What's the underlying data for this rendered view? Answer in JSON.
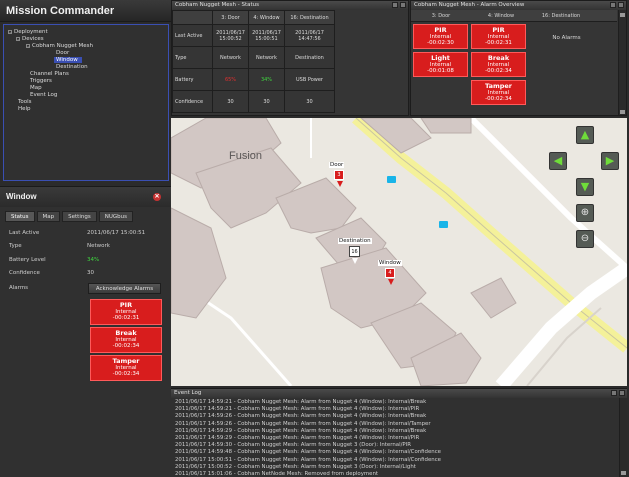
{
  "app": {
    "title": "Mission Commander"
  },
  "tree": {
    "items": [
      {
        "label": "Deployment",
        "toggle": "−"
      },
      {
        "label": "Devices",
        "toggle": "−"
      },
      {
        "label": "Cobham Nugget Mesh",
        "toggle": "−"
      },
      {
        "label": "Door"
      },
      {
        "label": "Window"
      },
      {
        "label": "Destination"
      },
      {
        "label": "Channel Plans"
      },
      {
        "label": "Triggers"
      },
      {
        "label": "Map"
      },
      {
        "label": "Event Log"
      },
      {
        "label": "Tools"
      },
      {
        "label": "Help"
      }
    ]
  },
  "window_panel": {
    "title": "Window",
    "close_icon": "✕",
    "tabs": [
      "Status",
      "Map",
      "Settings",
      "NUGbus"
    ],
    "rows": [
      {
        "k": "Last Active",
        "v": "2011/06/17 15:00:51"
      },
      {
        "k": "Type",
        "v": "Network"
      },
      {
        "k": "Battery Level",
        "v": "34%"
      },
      {
        "k": "Confidence",
        "v": "30"
      },
      {
        "k": "Alarms",
        "v": ""
      }
    ],
    "ack_label": "Acknowledge Alarms",
    "alarms": [
      {
        "name": "PIR",
        "src": "Internal",
        "time": "-00:02:31"
      },
      {
        "name": "Break",
        "src": "Internal",
        "time": "-00:02:34"
      },
      {
        "name": "Tamper",
        "src": "Internal",
        "time": "-00:02:34"
      }
    ]
  },
  "status_panel": {
    "title": "Cobham Nugget Mesh - Status",
    "headers": [
      "",
      "3: Door",
      "4: Window",
      "16: Destination"
    ],
    "rows": [
      {
        "label": "Last Active",
        "cells": [
          "2011/06/17\n15:00:52",
          "2011/06/17\n15:00:51",
          "2011/06/17\n14:47:56"
        ]
      },
      {
        "label": "Type",
        "cells": [
          "Network",
          "Network",
          "Destination"
        ]
      },
      {
        "label": "Battery",
        "cells": [
          "65%",
          "34%",
          "USB Power"
        ]
      },
      {
        "label": "Confidence",
        "cells": [
          "30",
          "30",
          "30"
        ]
      }
    ],
    "battery_colors": [
      "#e03030",
      "#3fd63f",
      "#dddddd"
    ]
  },
  "alarm_overview": {
    "title": "Cobham Nugget Mesh - Alarm Overview",
    "headers": [
      "3: Door",
      "4: Window",
      "16: Destination"
    ],
    "door": [
      {
        "name": "PIR",
        "src": "Internal",
        "time": "-00:02:30"
      },
      {
        "name": "Light",
        "src": "Internal",
        "time": "-00:01:08"
      }
    ],
    "window": [
      {
        "name": "PIR",
        "src": "Internal",
        "time": "-00:02:31"
      },
      {
        "name": "Break",
        "src": "Internal",
        "time": "-00:02:34"
      },
      {
        "name": "Tamper",
        "src": "Internal",
        "time": "-00:02:34"
      }
    ],
    "destination_text": "No Alarms"
  },
  "map": {
    "building_label": "Fusion",
    "markers": [
      {
        "label": "Door",
        "id": "3",
        "color": "#d81d1d"
      },
      {
        "label": "Destination",
        "id": "16",
        "color": "#ffffff"
      },
      {
        "label": "Window",
        "id": "4",
        "color": "#d81d1d"
      }
    ],
    "nav_icons": [
      "arrow-up-icon",
      "arrow-left-icon",
      "arrow-right-icon",
      "arrow-down-icon",
      "zoom-in-icon",
      "zoom-out-icon"
    ]
  },
  "event_log": {
    "title": "Event Log",
    "lines": [
      "2011/06/17 14:59:21 - Cobham Nugget Mesh: Alarm from Nugget 4 (Window): Internal/Break",
      "2011/06/17 14:59:21 - Cobham Nugget Mesh: Alarm from Nugget 4 (Window): Internal/PIR",
      "2011/06/17 14:59:26 - Cobham Nugget Mesh: Alarm from Nugget 4 (Window): Internal/Break",
      "2011/06/17 14:59:26 - Cobham Nugget Mesh: Alarm from Nugget 4 (Window): Internal/Tamper",
      "2011/06/17 14:59:29 - Cobham Nugget Mesh: Alarm from Nugget 4 (Window): Internal/Break",
      "2011/06/17 14:59:29 - Cobham Nugget Mesh: Alarm from Nugget 4 (Window): Internal/PIR",
      "2011/06/17 14:59:30 - Cobham Nugget Mesh: Alarm from Nugget 3 (Door): Internal/PIR",
      "2011/06/17 14:59:48 - Cobham Nugget Mesh: Alarm from Nugget 4 (Window): Internal/Confidence",
      "2011/06/17 15:00:51 - Cobham Nugget Mesh: Alarm from Nugget 4 (Window): Internal/Confidence",
      "2011/06/17 15:00:52 - Cobham Nugget Mesh: Alarm from Nugget 3 (Door): Internal/Light",
      "2011/06/17 15:01:06 - Cobham NetNode Mesh: Removed from deployment"
    ]
  }
}
